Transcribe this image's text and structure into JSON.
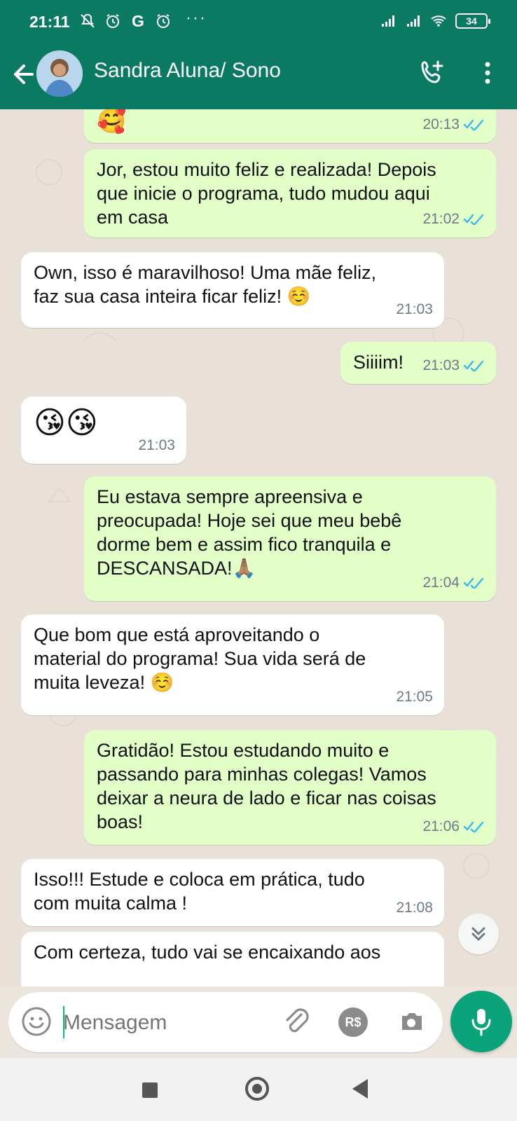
{
  "status_bar": {
    "time": "21:11",
    "more": "···",
    "battery": "34"
  },
  "header": {
    "contact_name": "Sandra Aluna/ Sono"
  },
  "messages": [
    {
      "side": "out",
      "text": "🥰",
      "time": "20:13",
      "read": true
    },
    {
      "side": "out",
      "text": "Jor, estou muito feliz e realizada! Depois\nque inicie o programa, tudo mudou aqui\nem casa",
      "time": "21:02",
      "read": true
    },
    {
      "side": "in",
      "text": "Own, isso é maravilhoso! Uma mãe feliz,\nfaz sua casa inteira ficar feliz! ☺️",
      "time": "21:03"
    },
    {
      "side": "out",
      "text": "Siiiim!",
      "time": "21:03",
      "read": true
    },
    {
      "side": "in",
      "text": "😘😘",
      "time": "21:03"
    },
    {
      "side": "out",
      "text": "Eu estava sempre apreensiva e\npreocupada! Hoje sei que meu bebê\ndorme bem e assim fico tranquila e\nDESCANSADA!🙏🏽",
      "time": "21:04",
      "read": true
    },
    {
      "side": "in",
      "text": "Que bom que está aproveitando o\nmaterial do programa!  Sua vida será de\nmuita leveza! ☺️",
      "time": "21:05"
    },
    {
      "side": "out",
      "text": "Gratidão! Estou estudando muito e\npassando para minhas colegas! Vamos\ndeixar a neura de lado e ficar nas coisas\nboas!",
      "time": "21:06",
      "read": true
    },
    {
      "side": "in",
      "text": "Isso!!! Estude e coloca em prática, tudo\ncom muita calma !",
      "time": "21:08"
    },
    {
      "side": "in",
      "text": "Com certeza, tudo vai se encaixando aos",
      "time": ""
    }
  ],
  "composer": {
    "placeholder": "Mensagem",
    "payment_label": "R$"
  },
  "colors": {
    "header": "#0a7a62",
    "outgoing_bubble": "#e2ffc8",
    "incoming_bubble": "#ffffff",
    "mic_button": "#0aa37a",
    "read_ticks": "#34b7f1"
  }
}
